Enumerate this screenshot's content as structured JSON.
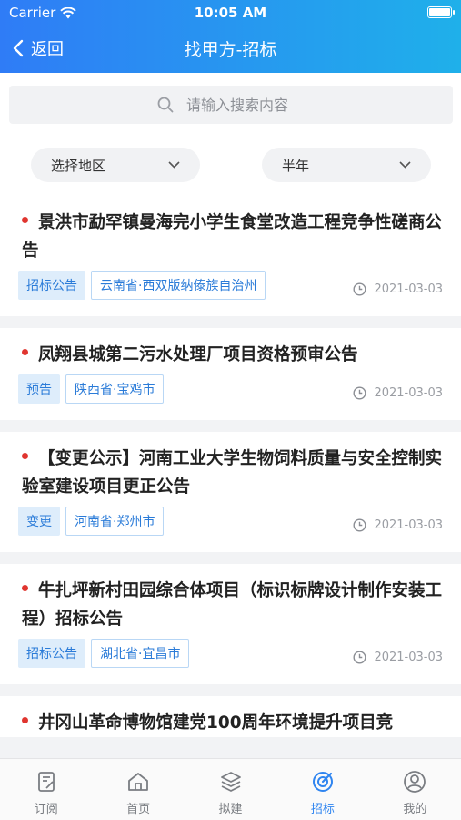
{
  "status": {
    "carrier": "Carrier",
    "time": "10:05 AM"
  },
  "nav": {
    "back_label": "返回",
    "title": "找甲方-招标"
  },
  "search": {
    "placeholder": "请输入搜索内容"
  },
  "filters": {
    "region_label": "选择地区",
    "time_label": "半年"
  },
  "items": [
    {
      "title": "景洪市勐罕镇曼海完小学生食堂改造工程竞争性磋商公告",
      "type": "招标公告",
      "region": "云南省·西双版纳傣族自治州",
      "date": "2021-03-03"
    },
    {
      "title": "凤翔县城第二污水处理厂项目资格预审公告",
      "type": "预告",
      "region": "陕西省·宝鸡市",
      "date": "2021-03-03"
    },
    {
      "title": "【变更公示】河南工业大学生物饲料质量与安全控制实验室建设项目更正公告",
      "type": "变更",
      "region": "河南省·郑州市",
      "date": "2021-03-03"
    },
    {
      "title": "牛扎坪新村田园综合体项目（标识标牌设计制作安装工程）招标公告",
      "type": "招标公告",
      "region": "湖北省·宜昌市",
      "date": "2021-03-03"
    },
    {
      "title": "井冈山革命博物馆建党100周年环境提升项目竞",
      "type": "",
      "region": "",
      "date": ""
    }
  ],
  "tabs": [
    {
      "label": "订阅",
      "icon": "subscribe-icon"
    },
    {
      "label": "首页",
      "icon": "home-icon"
    },
    {
      "label": "拟建",
      "icon": "layers-icon"
    },
    {
      "label": "招标",
      "icon": "bidding-icon"
    },
    {
      "label": "我的",
      "icon": "profile-icon"
    }
  ],
  "colors": {
    "header_start": "#2f7cf6",
    "header_end": "#1fb0ea",
    "accent": "#2f85f0",
    "dot": "#e0352f"
  }
}
